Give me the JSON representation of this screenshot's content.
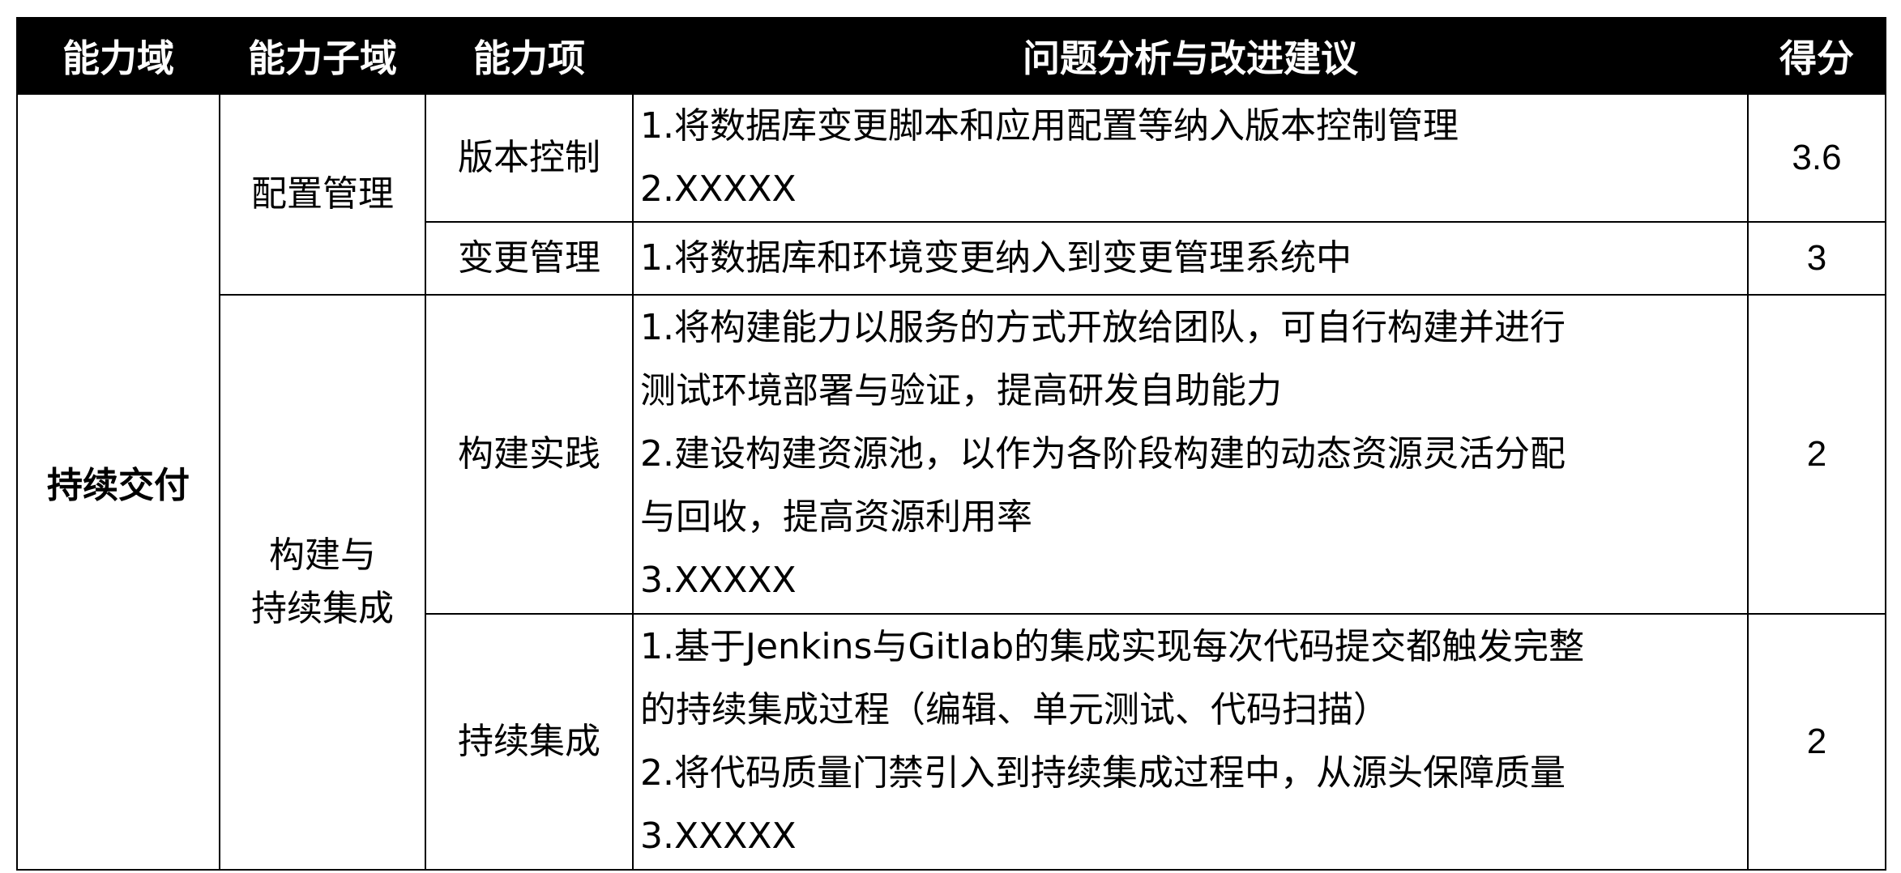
{
  "table": {
    "headers": [
      "能力域",
      "能力子域",
      "能力项",
      "问题分析与改进建议",
      "得分"
    ],
    "domain": "持续交付",
    "subdomains": [
      {
        "name_lines": [
          "配置管理"
        ]
      },
      {
        "name_lines": [
          "构建与",
          "持续集成"
        ]
      }
    ],
    "items": [
      {
        "name": "版本控制",
        "suggestions": [
          "1.将数据库变更脚本和应用配置等纳入版本控制管理",
          "2.XXXXX"
        ],
        "score": "3.6"
      },
      {
        "name": "变更管理",
        "suggestions": [
          "1.将数据库和环境变更纳入到变更管理系统中"
        ],
        "score": "3"
      },
      {
        "name": "构建实践",
        "suggestions": [
          "1.将构建能力以服务的方式开放给团队，可自行构建并进行",
          "测试环境部署与验证，提高研发自助能力",
          "2.建设构建资源池，以作为各阶段构建的动态资源灵活分配",
          "与回收，提高资源利用率",
          "3.XXXXX"
        ],
        "score": "2"
      },
      {
        "name": "持续集成",
        "suggestions": [
          "1.基于Jenkins与Gitlab的集成实现每次代码提交都触发完整",
          "的持续集成过程（编辑、单元测试、代码扫描）",
          "2.将代码质量门禁引入到持续集成过程中，从源头保障质量",
          "3.XXXXX"
        ],
        "score": "2"
      }
    ]
  }
}
